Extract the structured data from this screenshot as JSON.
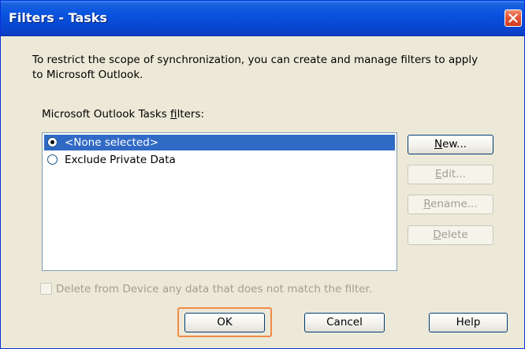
{
  "window": {
    "title": "Filters - Tasks"
  },
  "instructions": "To restrict the scope of synchronization, you can create and manage filters to apply to Microsoft Outlook.",
  "filters_label": {
    "prefix": "Microsoft Outlook Tasks ",
    "mnemonic": "f",
    "suffix": "ilters:"
  },
  "filters": [
    {
      "label": "<None selected>",
      "selected": true
    },
    {
      "label": "Exclude Private Data",
      "selected": false
    }
  ],
  "side_buttons": {
    "new": {
      "mnemonic": "N",
      "rest": "ew...",
      "enabled": true
    },
    "edit": {
      "mnemonic": "E",
      "rest": "dit...",
      "enabled": false
    },
    "rename": {
      "mnemonic": "R",
      "rest": "ename...",
      "enabled": false
    },
    "delete": {
      "mnemonic": "D",
      "rest": "elete",
      "enabled": false
    }
  },
  "delete_checkbox": {
    "label": "Delete from Device any data that does not match the filter.",
    "checked": false,
    "enabled": false
  },
  "footer_buttons": {
    "ok": "OK",
    "cancel": "Cancel",
    "help": "Help"
  },
  "colors": {
    "titlebar": "#0a55e0",
    "selection": "#316ac5",
    "focus_highlight": "#f08a47",
    "close_button": "#e3563a"
  },
  "icons": {
    "close": "close-icon"
  }
}
